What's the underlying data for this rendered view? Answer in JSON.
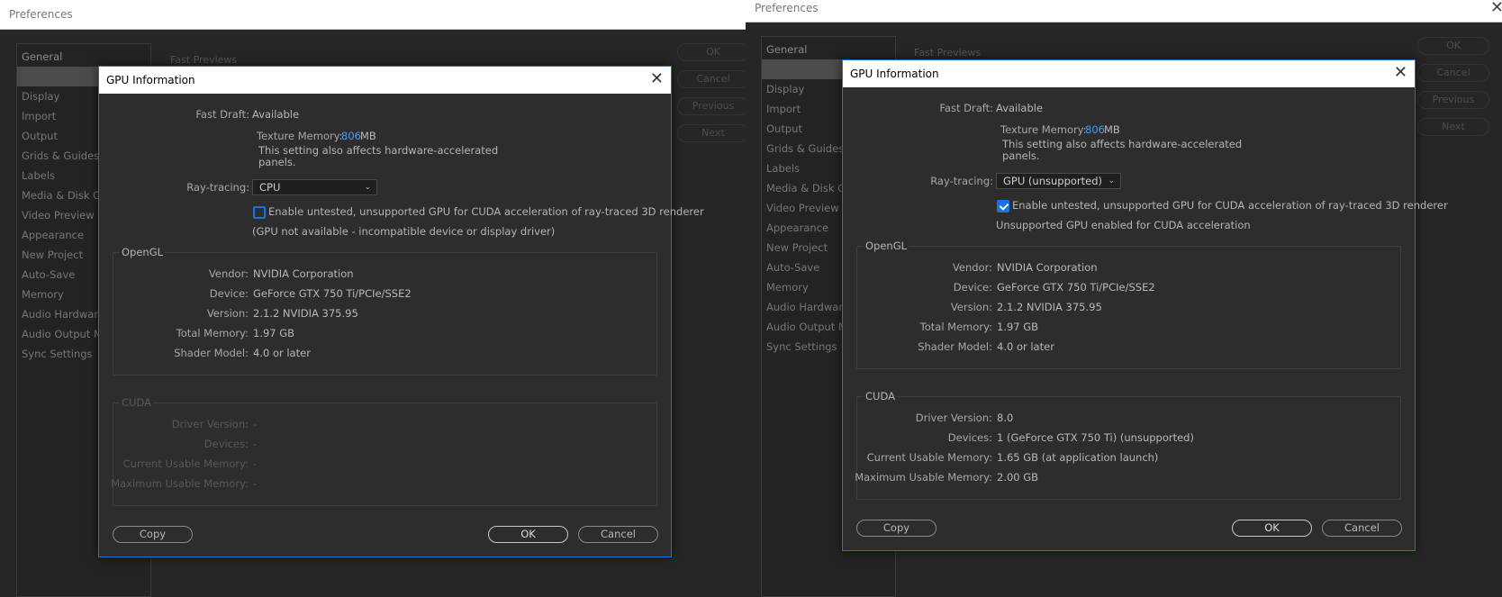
{
  "preferences": {
    "title": "Preferences",
    "sidebar": [
      "General",
      "",
      "Display",
      "Import",
      "Output",
      "Grids & Guides",
      "Labels",
      "Media & Disk Cache",
      "Video Preview",
      "Appearance",
      "New Project",
      "Auto-Save",
      "Memory",
      "Audio Hardware",
      "Audio Output Mapping",
      "Sync Settings"
    ],
    "section": "Fast Previews",
    "buttons": {
      "ok": "OK",
      "cancel": "Cancel",
      "previous": "Previous",
      "next": "Next"
    }
  },
  "dialog_left": {
    "title": "GPU Information",
    "fast_draft_label": "Fast Draft:",
    "fast_draft_value": "Available",
    "texture_label": "Texture Memory:",
    "texture_value": "806",
    "texture_unit": "MB",
    "texture_note_1": "This setting also affects hardware-accelerated",
    "texture_note_2": "panels.",
    "ray_label": "Ray-tracing:",
    "ray_value": "CPU",
    "checkbox_label": "Enable untested, unsupported GPU for CUDA acceleration of ray-traced 3D renderer",
    "checkbox_checked": false,
    "status": "(GPU not available - incompatible device or display driver)",
    "opengl": {
      "title": "OpenGL",
      "vendor_label": "Vendor:",
      "vendor": "NVIDIA Corporation",
      "device_label": "Device:",
      "device": "GeForce GTX 750 Ti/PCIe/SSE2",
      "version_label": "Version:",
      "version": "2.1.2 NVIDIA 375.95",
      "total_memory_label": "Total Memory:",
      "total_memory": "1.97 GB",
      "shader_label": "Shader Model:",
      "shader": "4.0 or later"
    },
    "cuda": {
      "title": "CUDA",
      "driver_label": "Driver Version:",
      "driver": "-",
      "devices_label": "Devices:",
      "devices": "-",
      "current_label": "Current Usable Memory:",
      "current": "-",
      "maximum_label": "Maximum Usable Memory:",
      "maximum": "-"
    },
    "copy": "Copy",
    "ok": "OK",
    "cancel": "Cancel"
  },
  "dialog_right": {
    "title": "GPU Information",
    "fast_draft_label": "Fast Draft:",
    "fast_draft_value": "Available",
    "texture_label": "Texture Memory:",
    "texture_value": "806",
    "texture_unit": "MB",
    "texture_note_1": "This setting also affects hardware-accelerated",
    "texture_note_2": "panels.",
    "ray_label": "Ray-tracing:",
    "ray_value": "GPU (unsupported)",
    "checkbox_label": "Enable untested, unsupported GPU for CUDA acceleration of ray-traced 3D renderer",
    "checkbox_checked": true,
    "status": "Unsupported GPU enabled for CUDA acceleration",
    "opengl": {
      "title": "OpenGL",
      "vendor_label": "Vendor:",
      "vendor": "NVIDIA Corporation",
      "device_label": "Device:",
      "device": "GeForce GTX 750 Ti/PCIe/SSE2",
      "version_label": "Version:",
      "version": "2.1.2 NVIDIA 375.95",
      "total_memory_label": "Total Memory:",
      "total_memory": "1.97 GB",
      "shader_label": "Shader Model:",
      "shader": "4.0 or later"
    },
    "cuda": {
      "title": "CUDA",
      "driver_label": "Driver Version:",
      "driver": "8.0",
      "devices_label": "Devices:",
      "devices": "1 (GeForce GTX 750 Ti) (unsupported)",
      "current_label": "Current Usable Memory:",
      "current": "1.65 GB (at application launch)",
      "maximum_label": "Maximum Usable Memory:",
      "maximum": "2.00 GB"
    },
    "copy": "Copy",
    "ok": "OK",
    "cancel": "Cancel"
  },
  "colors": {
    "accent": "#1473e6",
    "link_blue": "#4a9cf6",
    "dialog_bg": "#2d2d2d",
    "window_bg": "#262626"
  }
}
